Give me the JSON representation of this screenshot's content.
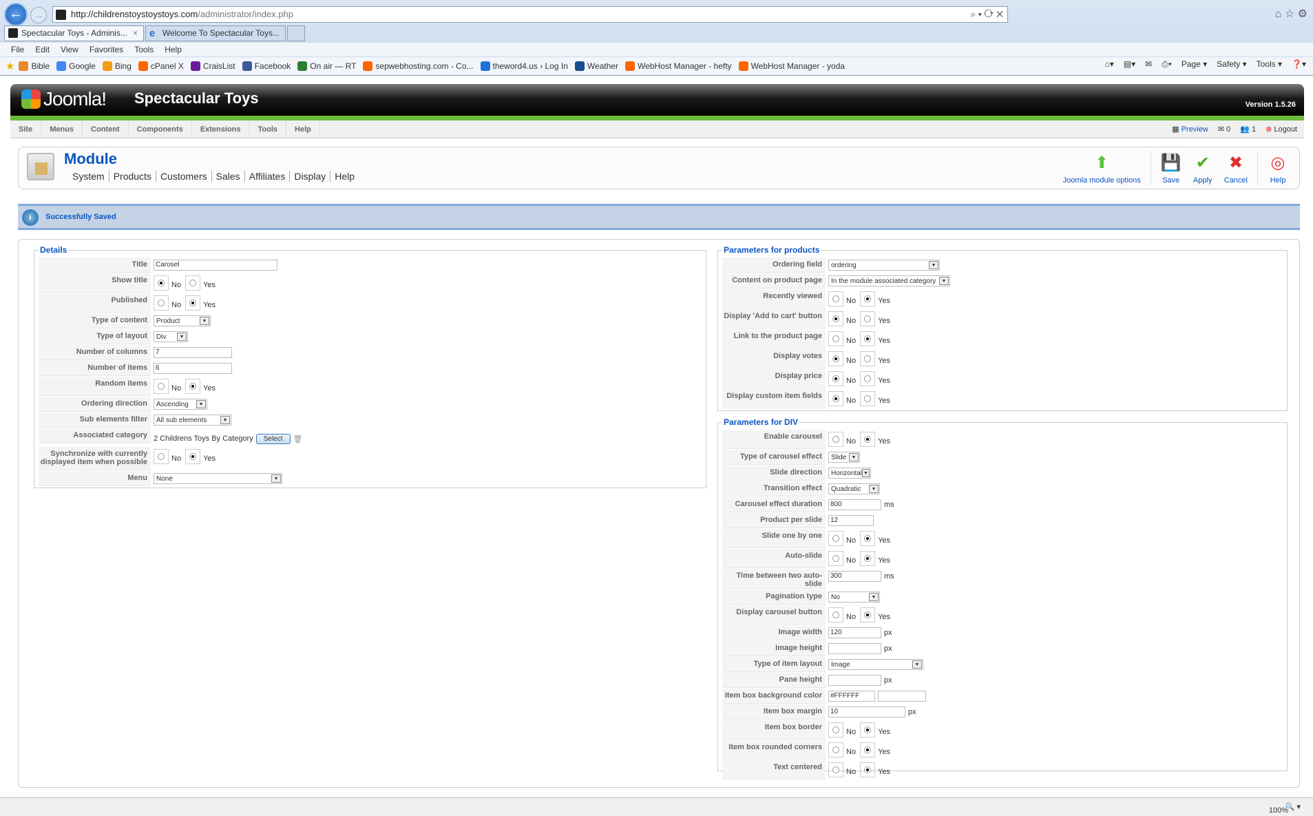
{
  "browser": {
    "url_domain": "http://childrenstoystoystoys.com",
    "url_path": "/administrator/index.php",
    "tabs": [
      {
        "label": "Spectacular Toys - Adminis...",
        "close": "×"
      },
      {
        "label": "Welcome To Spectacular Toys..."
      }
    ],
    "menu": [
      "File",
      "Edit",
      "View",
      "Favorites",
      "Tools",
      "Help"
    ],
    "favorites": [
      {
        "label": "Bible",
        "color": "#e88a2a"
      },
      {
        "label": "Google",
        "color": "#4285f4"
      },
      {
        "label": "Bing",
        "color": "#f39c12"
      },
      {
        "label": "cPanel X",
        "color": "#f60"
      },
      {
        "label": "CraisList",
        "color": "#6a1b9a"
      },
      {
        "label": "Facebook",
        "color": "#3b5998"
      },
      {
        "label": "On air — RT",
        "color": "#2e7d32"
      },
      {
        "label": "sepwebhosting.com - Co...",
        "color": "#f60"
      },
      {
        "label": "theword4.us › Log In",
        "color": "#1e73d8"
      },
      {
        "label": "Weather",
        "color": "#1a4d8f"
      },
      {
        "label": "WebHost Manager - hefty",
        "color": "#f60"
      },
      {
        "label": "WebHost Manager - yoda",
        "color": "#f60"
      }
    ],
    "commands": [
      "Page ▾",
      "Safety ▾",
      "Tools ▾"
    ],
    "zoom": "100%"
  },
  "header": {
    "logo": "Joomla!",
    "site_name": "Spectacular Toys",
    "version": "Version 1.5.26"
  },
  "topmenu": [
    "Site",
    "Menus",
    "Content",
    "Components",
    "Extensions",
    "Tools",
    "Help"
  ],
  "status": {
    "preview": "Preview",
    "messages": "0",
    "users": "1",
    "logout": "Logout"
  },
  "toolbar": {
    "title": "Module",
    "subnav": [
      "System",
      "Products",
      "Customers",
      "Sales",
      "Affiliates",
      "Display",
      "Help"
    ],
    "buttons": [
      {
        "label": "Joomla module options",
        "color": "#5cc23a"
      },
      {
        "label": "Save",
        "color": "#333"
      },
      {
        "label": "Apply",
        "color": "#4caf1c"
      },
      {
        "label": "Cancel",
        "color": "#e02b2b"
      },
      {
        "label": "Help",
        "color": "#e33"
      }
    ]
  },
  "message": "Successfully Saved",
  "radio_labels": {
    "no": "No",
    "yes": "Yes"
  },
  "details": {
    "legend": "Details",
    "rows": [
      {
        "label": "Title",
        "type": "text",
        "value": "Carosel"
      },
      {
        "label": "Show title",
        "type": "radio",
        "selected": "No"
      },
      {
        "label": "Published",
        "type": "radio",
        "selected": "Yes"
      },
      {
        "label": "Type of content",
        "type": "select",
        "value": "Product"
      },
      {
        "label": "Type of layout",
        "type": "select",
        "value": "Div"
      },
      {
        "label": "Number of columns",
        "type": "text",
        "value": "7"
      },
      {
        "label": "Number of items",
        "type": "text",
        "value": "6"
      },
      {
        "label": "Random items",
        "type": "radio",
        "selected": "Yes"
      },
      {
        "label": "Ordering direction",
        "type": "select",
        "value": "Ascending"
      },
      {
        "label": "Sub elements filter",
        "type": "select",
        "value": "All sub elements"
      },
      {
        "label": "Associated category",
        "type": "category",
        "value": "2 Childrens Toys By Category",
        "button": "Select"
      },
      {
        "label": "Synchronize with currently displayed item when possible",
        "type": "radio",
        "selected": "Yes"
      },
      {
        "label": "Menu",
        "type": "select",
        "value": "None"
      }
    ]
  },
  "products": {
    "legend": "Parameters for products",
    "rows": [
      {
        "label": "Ordering field",
        "type": "select",
        "value": "ordering"
      },
      {
        "label": "Content on product page",
        "type": "select",
        "value": "In the module associated category"
      },
      {
        "label": "Recently viewed",
        "type": "radio",
        "selected": "Yes"
      },
      {
        "label": "Display 'Add to cart' button",
        "type": "radio",
        "selected": "No"
      },
      {
        "label": "Link to the product page",
        "type": "radio",
        "selected": "Yes"
      },
      {
        "label": "Display votes",
        "type": "radio",
        "selected": "No"
      },
      {
        "label": "Display price",
        "type": "radio",
        "selected": "No"
      },
      {
        "label": "Display custom item fields",
        "type": "radio",
        "selected": "No"
      }
    ]
  },
  "div": {
    "legend": "Parameters for DIV",
    "rows": [
      {
        "label": "Enable carousel",
        "type": "radio",
        "selected": "Yes"
      },
      {
        "label": "Type of carousel effect",
        "type": "select",
        "value": "Slide"
      },
      {
        "label": "Slide direction",
        "type": "select",
        "value": "Horizontal"
      },
      {
        "label": "Transition effect",
        "type": "select",
        "value": "Quadratic"
      },
      {
        "label": "Carousel effect duration",
        "type": "text",
        "value": "800",
        "suffix": "ms"
      },
      {
        "label": "Product per slide",
        "type": "text",
        "value": "12"
      },
      {
        "label": "Slide one by one",
        "type": "radio",
        "selected": "Yes"
      },
      {
        "label": "Auto-slide",
        "type": "radio",
        "selected": "Yes"
      },
      {
        "label": "Time between two auto-slide",
        "type": "text",
        "value": "300",
        "suffix": "ms"
      },
      {
        "label": "Pagination type",
        "type": "select",
        "value": "No"
      },
      {
        "label": "Display carousel button",
        "type": "radio",
        "selected": "Yes"
      },
      {
        "label": "Image width",
        "type": "text",
        "value": "120",
        "suffix": "px"
      },
      {
        "label": "Image height",
        "type": "text",
        "value": "",
        "suffix": "px"
      },
      {
        "label": "Type of item layout",
        "type": "select",
        "value": "Image"
      },
      {
        "label": "Pane height",
        "type": "text",
        "value": "",
        "suffix": "px"
      },
      {
        "label": "Item box background color",
        "type": "color",
        "value": "#FFFFFF"
      },
      {
        "label": "Item box margin",
        "type": "text",
        "value": "10",
        "suffix": "px"
      },
      {
        "label": "Item box border",
        "type": "radio",
        "selected": "Yes"
      },
      {
        "label": "Item box rounded corners",
        "type": "radio",
        "selected": "Yes"
      },
      {
        "label": "Text centered",
        "type": "radio",
        "selected": "Yes"
      }
    ]
  }
}
